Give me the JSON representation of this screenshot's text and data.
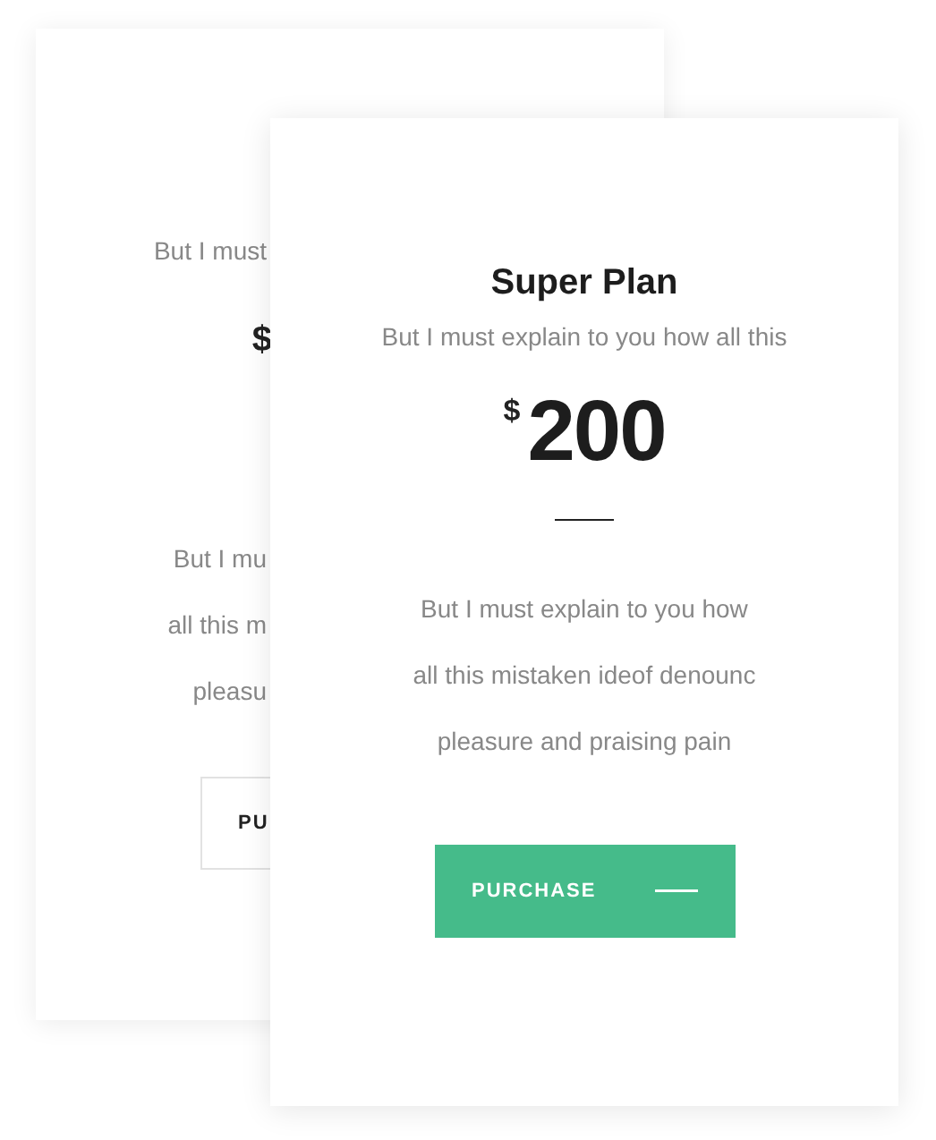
{
  "back_card": {
    "subtitle": "But I must",
    "price_currency": "$",
    "description_lines": [
      "But I mu",
      "all this m",
      "pleasu"
    ],
    "button": "PU"
  },
  "front_card": {
    "title": "Super Plan",
    "subtitle": "But I must explain to you how all this",
    "price_currency": "$",
    "price": "200",
    "description_lines": [
      "But I must explain to you how",
      "all this mistaken ideof denounc",
      "pleasure and praising pain"
    ],
    "button": "PURCHASE"
  }
}
